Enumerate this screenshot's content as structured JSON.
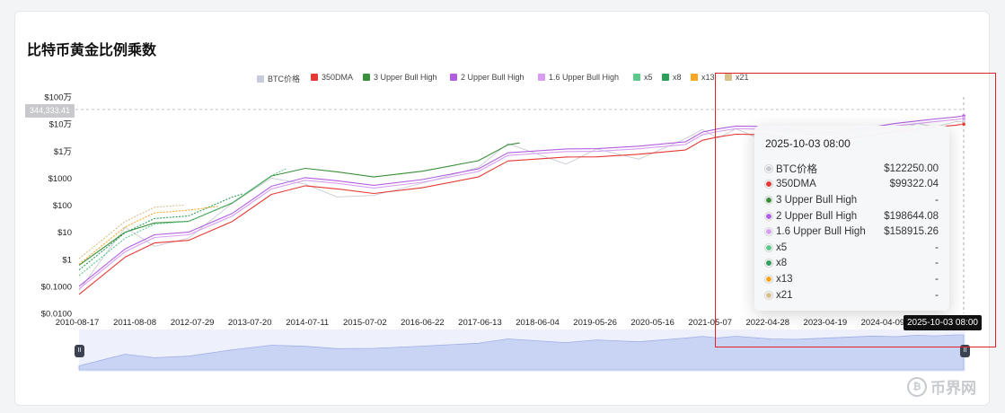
{
  "title": "比特币黄金比例乘数",
  "legend": [
    {
      "label": "BTC价格",
      "color": "#c8ccd4"
    },
    {
      "label": "350DMA",
      "color": "#e53935"
    },
    {
      "label": "3 Upper Bull High",
      "color": "#3a8f3a"
    },
    {
      "label": "2 Upper Bull High",
      "color": "#b15ee0"
    },
    {
      "label": "1.6 Upper Bull High",
      "color": "#d79cf0"
    },
    {
      "label": "x5",
      "color": "#5cc88a"
    },
    {
      "label": "x8",
      "color": "#2e9e5b"
    },
    {
      "label": "x13",
      "color": "#f5a623"
    },
    {
      "label": "x21",
      "color": "#d8c08a"
    }
  ],
  "crosshair": {
    "y_value_label": "344,333.41",
    "x_date_label": "2025-10-03 08:00"
  },
  "tooltip": {
    "date": "2025-10-03 08:00",
    "rows": [
      {
        "name": "BTC价格",
        "value": "$122250.00",
        "color": "#c8ccd4"
      },
      {
        "name": "350DMA",
        "value": "$99322.04",
        "color": "#e53935"
      },
      {
        "name": "3 Upper Bull High",
        "value": "-",
        "color": "#3a8f3a"
      },
      {
        "name": "2 Upper Bull High",
        "value": "$198644.08",
        "color": "#b15ee0"
      },
      {
        "name": "1.6 Upper Bull High",
        "value": "$158915.26",
        "color": "#d79cf0"
      },
      {
        "name": "x5",
        "value": "-",
        "color": "#5cc88a"
      },
      {
        "name": "x8",
        "value": "-",
        "color": "#2e9e5b"
      },
      {
        "name": "x13",
        "value": "-",
        "color": "#f5a623"
      },
      {
        "name": "x21",
        "value": "-",
        "color": "#d8c08a"
      }
    ]
  },
  "chart_data": {
    "type": "line",
    "y_scale": "log",
    "ylim": [
      0.01,
      1000000
    ],
    "y_ticks": [
      {
        "value": 1000000,
        "label": "$100万"
      },
      {
        "value": 100000,
        "label": "$10万"
      },
      {
        "value": 10000,
        "label": "$1万"
      },
      {
        "value": 1000,
        "label": "$1000"
      },
      {
        "value": 100,
        "label": "$100"
      },
      {
        "value": 10,
        "label": "$10"
      },
      {
        "value": 1,
        "label": "$1"
      },
      {
        "value": 0.1,
        "label": "$0.1000"
      },
      {
        "value": 0.01,
        "label": "$0.0100"
      }
    ],
    "x_ticks": [
      "2010-08-17",
      "2011-08-08",
      "2012-07-29",
      "2013-07-20",
      "2014-07-11",
      "2015-07-02",
      "2016-06-22",
      "2017-06-13",
      "2018-06-04",
      "2019-05-26",
      "2020-05-16",
      "2021-05-07",
      "2022-04-28",
      "2023-04-19",
      "2024-04-09",
      "2025-10-03 08:00"
    ],
    "x_range": [
      "2010-08-17",
      "2025-10-03"
    ],
    "grid": false,
    "legend_position": "top-center",
    "series": [
      {
        "name": "BTC价格",
        "x": [
          "2010-08-17",
          "2011-06-01",
          "2011-12-01",
          "2012-07-01",
          "2013-04-01",
          "2013-12-01",
          "2014-07-01",
          "2015-01-15",
          "2015-09-01",
          "2016-07-01",
          "2017-06-15",
          "2017-12-17",
          "2018-12-15",
          "2019-06-26",
          "2020-03-13",
          "2020-12-31",
          "2021-04-14",
          "2021-07-20",
          "2021-11-10",
          "2022-06-18",
          "2022-11-21",
          "2023-06-30",
          "2024-03-14",
          "2024-08-05",
          "2024-12-17",
          "2025-04-08",
          "2025-08-14",
          "2025-10-03"
        ],
        "values": [
          0.07,
          15,
          3,
          6,
          120,
          1000,
          600,
          200,
          230,
          650,
          2500,
          19000,
          3300,
          12000,
          5000,
          29000,
          63000,
          30000,
          67000,
          19000,
          16000,
          30500,
          73000,
          54000,
          106000,
          77000,
          123000,
          122250
        ]
      },
      {
        "name": "350DMA",
        "x": [
          "2010-08-17",
          "2011-06-01",
          "2011-12-01",
          "2012-07-01",
          "2013-04-01",
          "2013-12-01",
          "2014-07-01",
          "2015-01-15",
          "2015-09-01",
          "2016-07-01",
          "2017-06-15",
          "2017-12-17",
          "2018-12-15",
          "2019-06-26",
          "2020-03-13",
          "2020-12-31",
          "2021-04-14",
          "2021-07-20",
          "2021-11-10",
          "2022-06-18",
          "2022-11-21",
          "2023-06-30",
          "2024-03-14",
          "2024-08-05",
          "2024-12-17",
          "2025-04-08",
          "2025-08-14",
          "2025-10-03"
        ],
        "values": [
          0.05,
          1.2,
          4,
          5,
          25,
          250,
          520,
          400,
          270,
          440,
          1100,
          4300,
          6000,
          6100,
          7600,
          11000,
          25000,
          33000,
          42000,
          40000,
          28000,
          24000,
          39000,
          53000,
          65000,
          77000,
          91000,
          99322.04
        ]
      },
      {
        "name": "3 Upper Bull High",
        "x": [
          "2010-08-17",
          "2011-06-01",
          "2011-12-01",
          "2012-07-01",
          "2013-04-01",
          "2013-12-01",
          "2014-07-01",
          "2015-01-15",
          "2015-09-01",
          "2016-07-01",
          "2017-06-15",
          "2017-12-17",
          "2018-03-01"
        ],
        "values": [
          0.6,
          10,
          22,
          25,
          120,
          1200,
          2300,
          1700,
          1100,
          1800,
          4400,
          17000,
          20000
        ]
      },
      {
        "name": "2 Upper Bull High",
        "x": [
          "2010-08-17",
          "2011-06-01",
          "2011-12-01",
          "2012-07-01",
          "2013-04-01",
          "2013-12-01",
          "2014-07-01",
          "2015-01-15",
          "2015-09-01",
          "2016-07-01",
          "2017-06-15",
          "2017-12-17",
          "2018-12-15",
          "2019-06-26",
          "2020-03-13",
          "2020-12-31",
          "2021-04-14",
          "2021-07-20",
          "2021-11-10",
          "2022-06-18",
          "2022-11-21",
          "2023-06-30",
          "2024-03-14",
          "2024-08-05",
          "2024-12-17",
          "2025-04-08",
          "2025-08-14",
          "2025-10-03"
        ],
        "values": [
          0.1,
          2.4,
          8,
          10,
          50,
          500,
          1040,
          800,
          540,
          880,
          2200,
          8600,
          12000,
          12200,
          15200,
          22000,
          50000,
          66000,
          84000,
          80000,
          56000,
          48000,
          78000,
          106000,
          130000,
          154000,
          182000,
          198644.08
        ]
      },
      {
        "name": "1.6 Upper Bull High",
        "x": [
          "2010-08-17",
          "2011-06-01",
          "2011-12-01",
          "2012-07-01",
          "2013-04-01",
          "2013-12-01",
          "2014-07-01",
          "2015-01-15",
          "2015-09-01",
          "2016-07-01",
          "2017-06-15",
          "2017-12-17",
          "2018-12-15",
          "2019-06-26",
          "2020-03-13",
          "2020-12-31",
          "2021-04-14",
          "2021-07-20",
          "2021-11-10",
          "2022-06-18",
          "2022-11-21",
          "2023-06-30",
          "2024-03-14",
          "2024-08-05",
          "2024-12-17",
          "2025-04-08",
          "2025-08-14",
          "2025-10-03"
        ],
        "values": [
          0.08,
          1.9,
          6.4,
          8,
          40,
          400,
          832,
          640,
          432,
          704,
          1760,
          6880,
          9600,
          9760,
          12160,
          17600,
          40000,
          52800,
          67200,
          64000,
          44800,
          38400,
          62400,
          84800,
          104000,
          123200,
          145600,
          158915.26
        ]
      },
      {
        "name": "x5",
        "x": [
          "2010-08-17",
          "2011-06-01",
          "2011-12-01",
          "2012-07-01",
          "2013-04-01",
          "2013-12-01",
          "2014-03-01"
        ],
        "values": [
          0.25,
          6,
          20,
          25,
          125,
          1250,
          2200
        ]
      },
      {
        "name": "x8",
        "x": [
          "2010-08-17",
          "2011-06-01",
          "2011-12-01",
          "2012-07-01",
          "2013-04-01",
          "2013-06-01"
        ],
        "values": [
          0.4,
          9.6,
          32,
          40,
          200,
          260
        ]
      },
      {
        "name": "x13",
        "x": [
          "2010-08-17",
          "2011-06-01",
          "2011-12-01",
          "2012-07-01",
          "2013-01-01"
        ],
        "values": [
          0.65,
          15.6,
          52,
          65,
          90
        ]
      },
      {
        "name": "x21",
        "x": [
          "2010-08-17",
          "2011-06-01",
          "2011-12-01",
          "2012-06-01"
        ],
        "values": [
          1.05,
          25,
          84,
          100
        ]
      }
    ]
  },
  "watermark": {
    "icon": "bitcoin-coin-icon",
    "text": "币界网"
  },
  "slider": {
    "left_handle": "II",
    "right_handle": "II"
  }
}
